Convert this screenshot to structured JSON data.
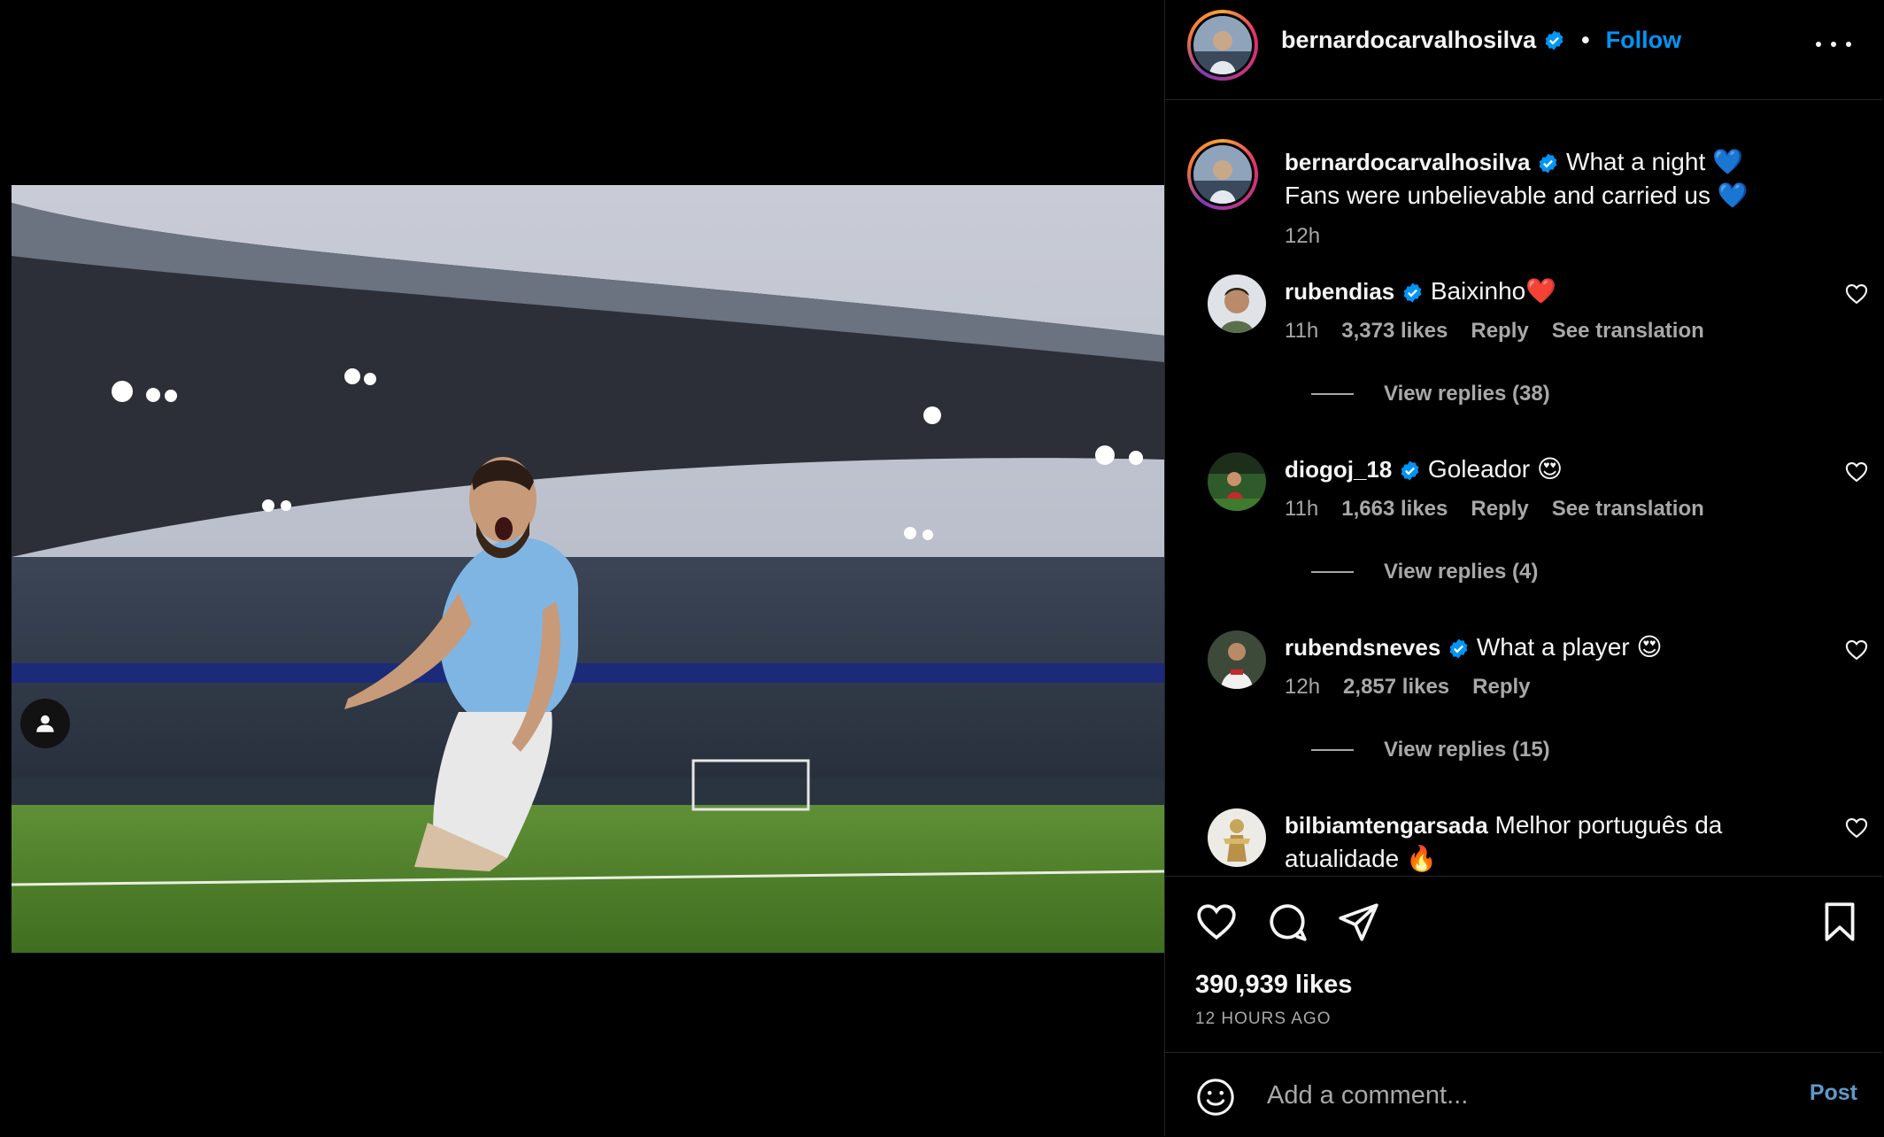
{
  "post": {
    "username": "bernardocarvalhosilva",
    "follow_label": "Follow",
    "separator": "•",
    "caption_line1": "What a night 💙",
    "caption_line2": "Fans were unbelievable and carried us 💙",
    "caption_time": "12h",
    "likes": "390,939 likes",
    "time_ago": "12 HOURS AGO"
  },
  "comments": [
    {
      "username": "rubendias",
      "text": "Baixinho❤️",
      "time": "11h",
      "likes": "3,373 likes",
      "reply_label": "Reply",
      "translate_label": "See translation",
      "view_replies": "View replies (38)"
    },
    {
      "username": "diogoj_18",
      "text": "Goleador 😍",
      "time": "11h",
      "likes": "1,663 likes",
      "reply_label": "Reply",
      "translate_label": "See translation",
      "view_replies": "View replies (4)"
    },
    {
      "username": "rubendsneves",
      "text": "What a player 😍",
      "time": "12h",
      "likes": "2,857 likes",
      "reply_label": "Reply",
      "view_replies": "View replies (15)"
    },
    {
      "username": "bilbiamtengarsada",
      "text": "Melhor português da atualidade 🔥"
    }
  ],
  "add_comment": {
    "placeholder": "Add a comment...",
    "post_label": "Post"
  },
  "colors": {
    "accent": "#0095f6",
    "muted": "#a8a8a8",
    "background": "#000000"
  },
  "icons": [
    "user-tag-icon",
    "verified-icon",
    "more-options-icon",
    "heart-icon",
    "comment-icon",
    "share-icon",
    "bookmark-icon",
    "emoji-icon"
  ]
}
